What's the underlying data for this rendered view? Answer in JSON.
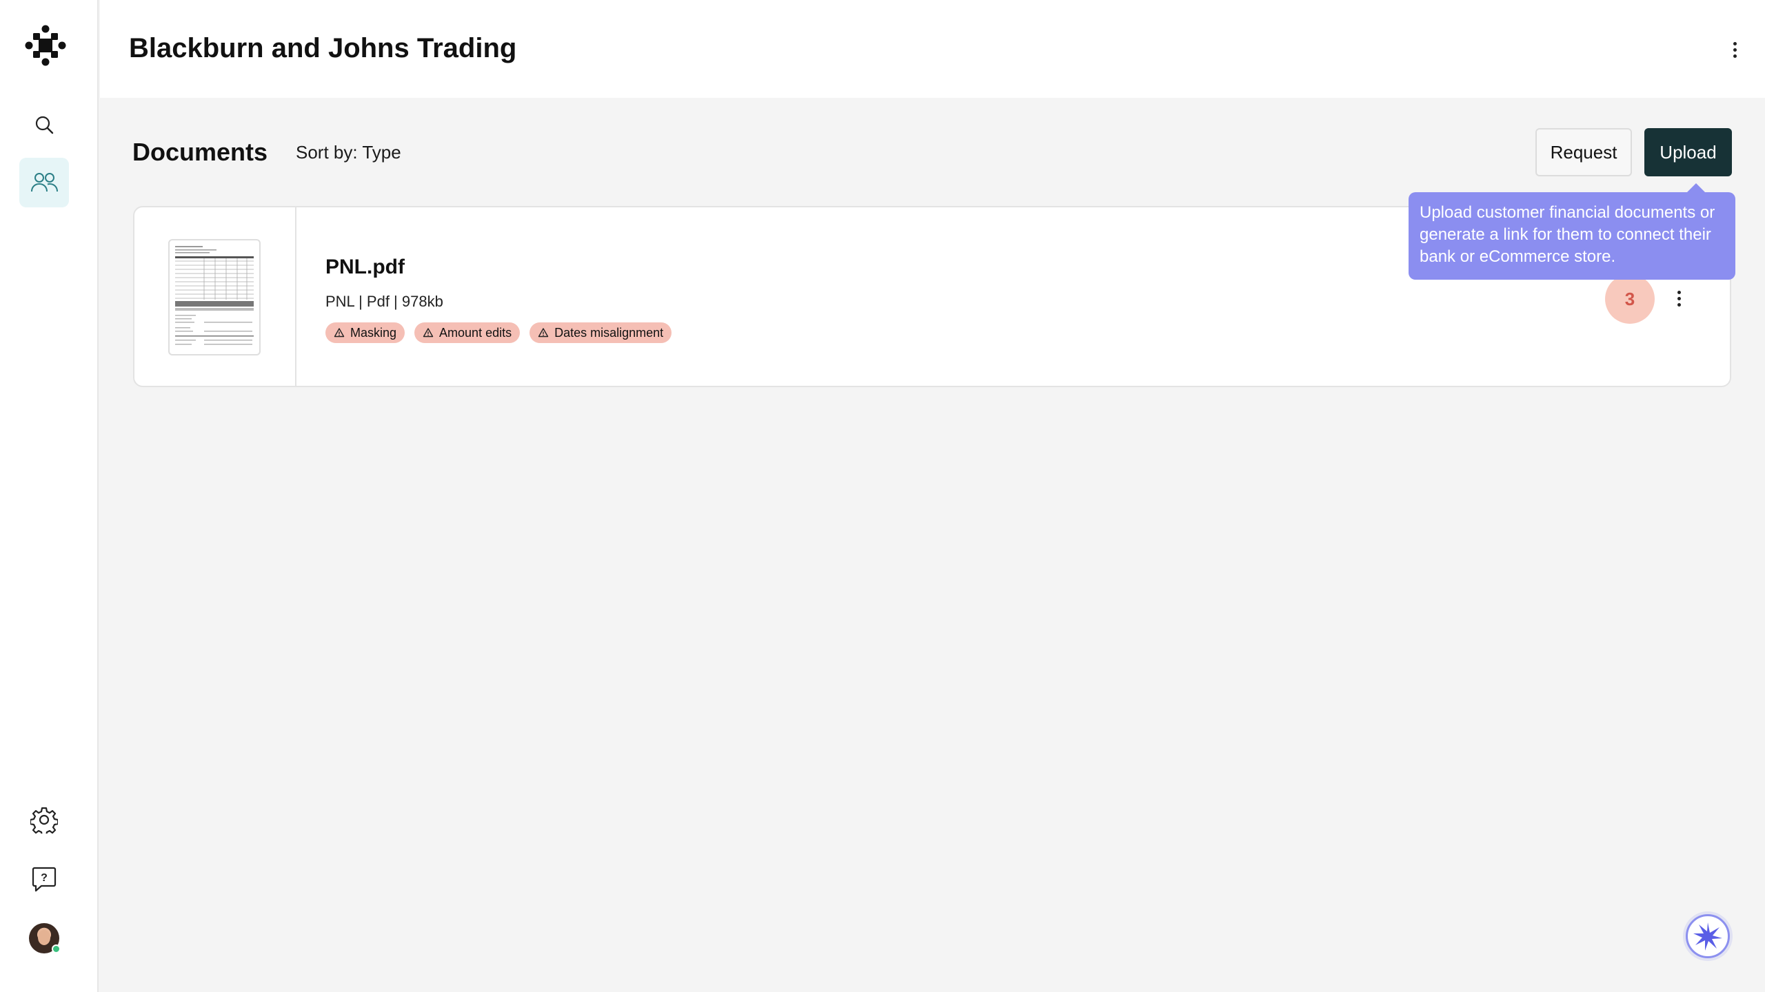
{
  "header": {
    "title": "Blackburn and Johns Trading",
    "menu_icon": "more-vertical-icon"
  },
  "sidebar": {
    "logo_icon": "brand-logo-icon",
    "items": [
      {
        "icon": "search-icon",
        "label": "Search"
      },
      {
        "icon": "users-icon",
        "label": "Customers",
        "active": true
      }
    ],
    "bottom": [
      {
        "icon": "gear-icon",
        "label": "Settings"
      },
      {
        "icon": "help-chat-icon",
        "label": "Help"
      },
      {
        "icon": "avatar",
        "status_color": "#39c07f"
      }
    ]
  },
  "documents": {
    "title": "Documents",
    "sort_label": "Sort by: Type",
    "request_button": "Request",
    "upload_button": "Upload",
    "items": [
      {
        "name": "PNL.pdf",
        "meta": "PNL | Pdf | 978kb",
        "tags": [
          "Masking",
          "Amount edits",
          "Dates misalignment"
        ],
        "issue_count": "3"
      }
    ]
  },
  "tooltip": {
    "text": "Upload customer financial documents or generate a link for them to connect their bank or eCommerce store."
  },
  "colors": {
    "accent_dark": "#173236",
    "tooltip": "#8b8ef0",
    "tag_bg": "#f5bfb5",
    "badge_bg": "#f8c9bd",
    "badge_text": "#d2564a",
    "active_nav": "#e6f5f7"
  }
}
